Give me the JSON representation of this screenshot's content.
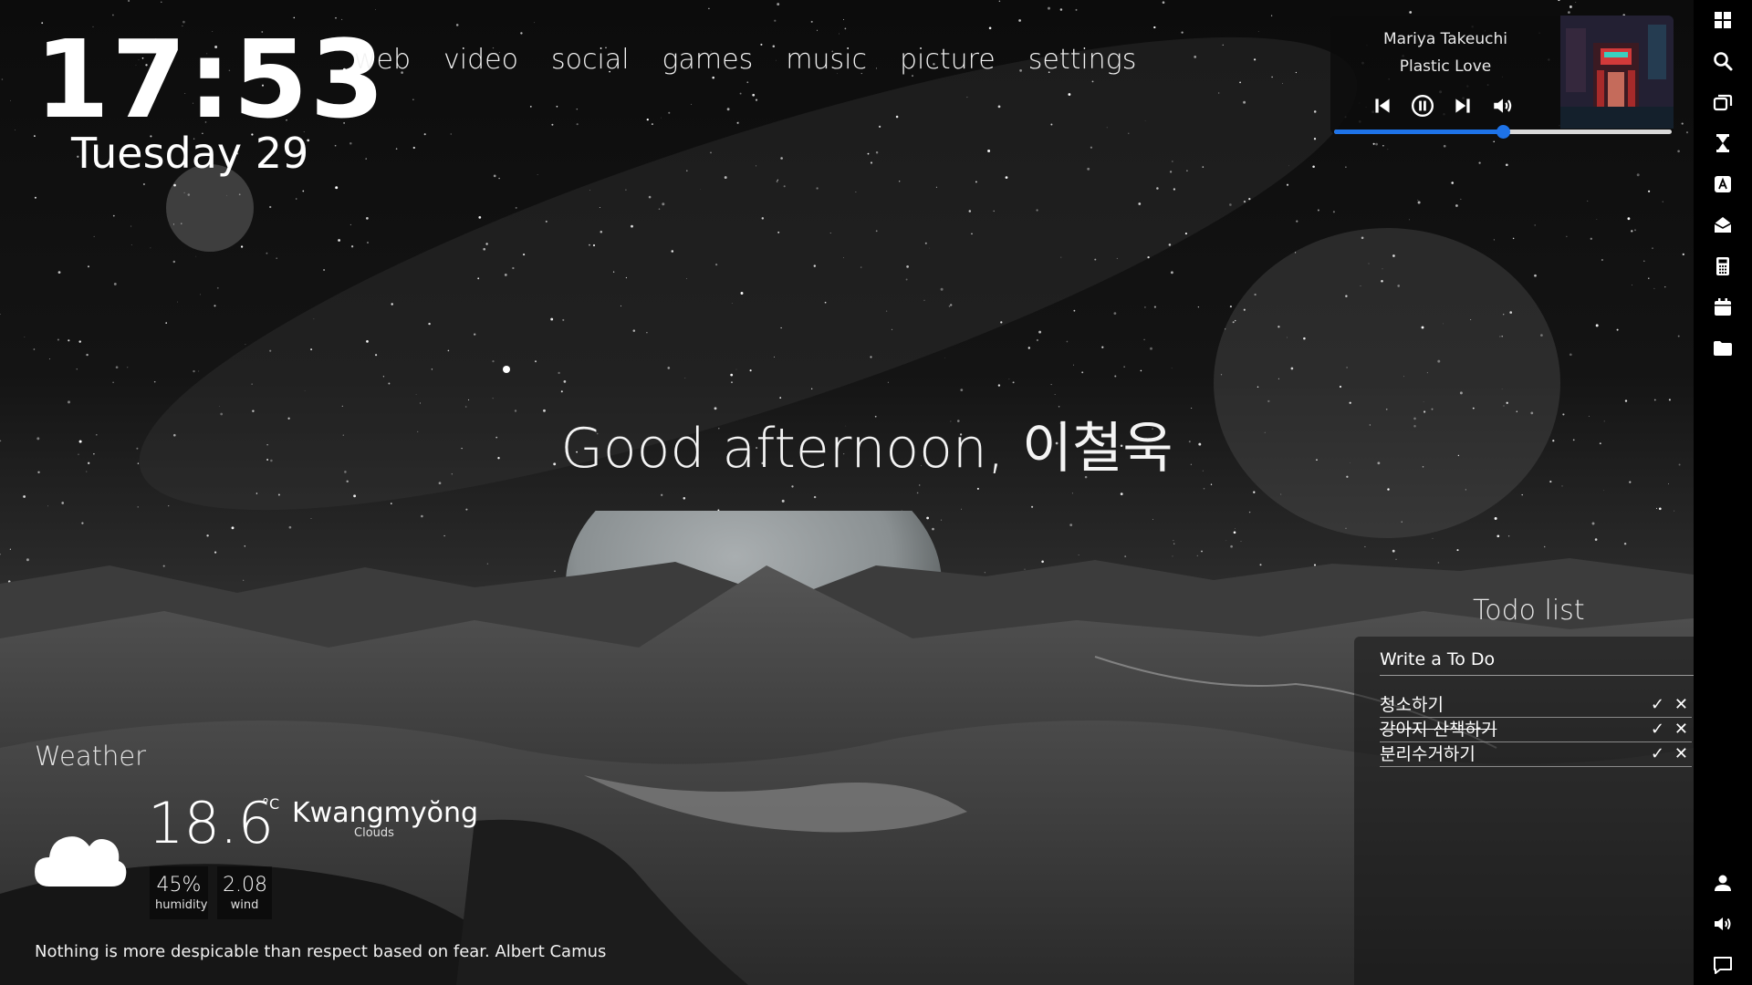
{
  "clock": {
    "time": "17:53",
    "date": "Tuesday 29"
  },
  "nav": {
    "items": [
      {
        "label": "web"
      },
      {
        "label": "video"
      },
      {
        "label": "social"
      },
      {
        "label": "games"
      },
      {
        "label": "music"
      },
      {
        "label": "picture"
      },
      {
        "label": "settings"
      }
    ]
  },
  "greeting": "Good afternoon, 이철욱",
  "player": {
    "artist": "Mariya Takeuchi",
    "title": "Plastic Love",
    "progress_fraction": 0.5,
    "accent_color": "#1e73e8",
    "controls": [
      "previous-icon",
      "pause-icon",
      "next-icon",
      "volume-icon"
    ]
  },
  "taskbar": {
    "top_icons": [
      "windows-icon",
      "search-icon",
      "task-view-icon",
      "hourglass-icon",
      "app-store-icon",
      "mail-icon",
      "calculator-icon",
      "calendar-icon",
      "folder-icon"
    ],
    "bottom_icons": [
      "user-icon",
      "volume-icon",
      "chat-icon"
    ]
  },
  "todo": {
    "title": "Todo list",
    "placeholder": "Write a To Do",
    "items": [
      {
        "text": "청소하기",
        "done": false
      },
      {
        "text": "강아지 산책하기",
        "done": true
      },
      {
        "text": "분리수거하기",
        "done": false
      }
    ],
    "check_symbol": "✓",
    "delete_symbol": "✕"
  },
  "weather": {
    "title": "Weather",
    "temperature": "18.6",
    "unit": "°C",
    "city": "Kwangmyŏng",
    "condition": "Clouds",
    "humidity_value": "45%",
    "humidity_label": "humidity",
    "wind_value": "2.08",
    "wind_label": "wind",
    "icon": "cloud-icon"
  },
  "quote": "Nothing is more despicable than respect based on fear. Albert Camus"
}
